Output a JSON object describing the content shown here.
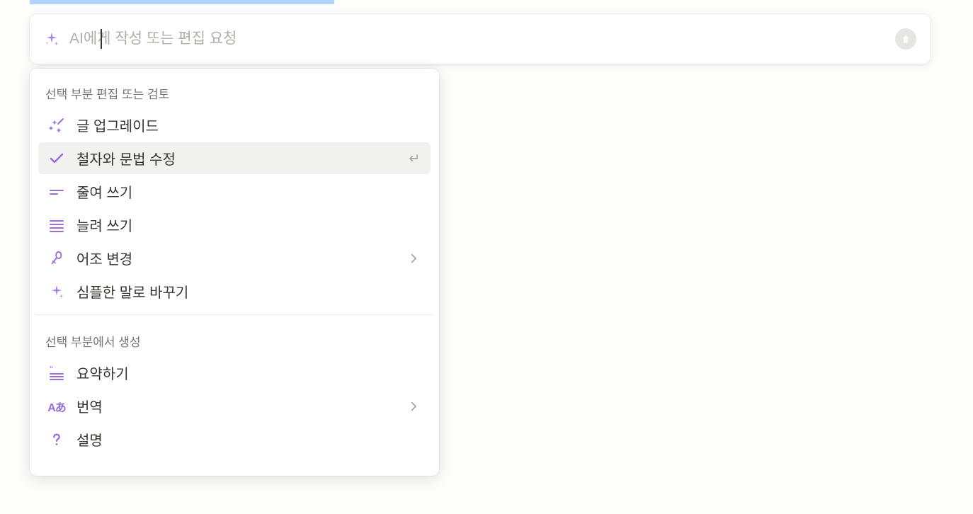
{
  "input": {
    "placeholder": "AI에게 작성 또는 편집 요청"
  },
  "sections": {
    "edit": {
      "header": "선택 부분 편집 또는 검토",
      "items": {
        "upgrade": {
          "label": "글 업그레이드"
        },
        "spelling": {
          "label": "철자와 문법 수정"
        },
        "shorten": {
          "label": "줄여 쓰기"
        },
        "lengthen": {
          "label": "늘려 쓰기"
        },
        "tone": {
          "label": "어조 변경"
        },
        "simplify": {
          "label": "심플한 말로 바꾸기"
        }
      }
    },
    "generate": {
      "header": "선택 부분에서 생성",
      "items": {
        "summarize": {
          "label": "요약하기"
        },
        "translate": {
          "label": "번역"
        },
        "explain": {
          "label": "설명"
        }
      }
    }
  },
  "icons": {
    "translate_text": "Aあ"
  }
}
